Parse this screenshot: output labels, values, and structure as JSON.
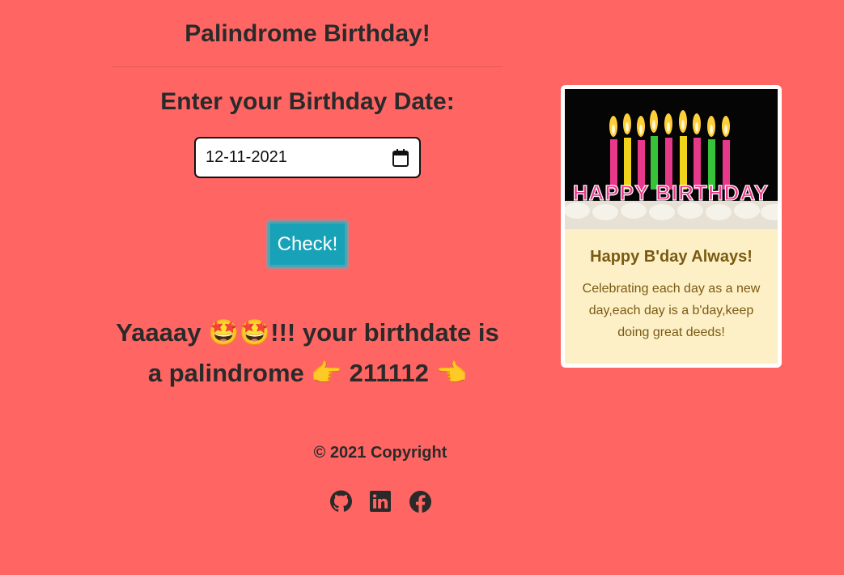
{
  "header": {
    "title": "Palindrome Birthday!"
  },
  "form": {
    "prompt": "Enter your Birthday Date:",
    "date_value": "12-11-2021",
    "check_label": "Check!"
  },
  "result": {
    "part1": "Yaaaay ",
    "part2": "!!! your birthdate is a palindrome ",
    "palindrome": " 211112 ",
    "emoji_star": "🤩",
    "emoji_right": "👉",
    "emoji_left": "👈"
  },
  "card": {
    "image_text": "HAPPY BIRTHDAY",
    "title": "Happy B'day Always!",
    "text": "Celebrating each day as a new day,each day is a b'day,keep doing great deeds!"
  },
  "footer": {
    "copyright": "© 2021 Copyright",
    "social_icons": [
      "github-icon",
      "linkedin-icon",
      "facebook-icon"
    ]
  },
  "colors": {
    "background": "#ff6663",
    "button": "#17a2b8",
    "card_body": "#fdf0c7",
    "card_text": "#7a5a12"
  }
}
